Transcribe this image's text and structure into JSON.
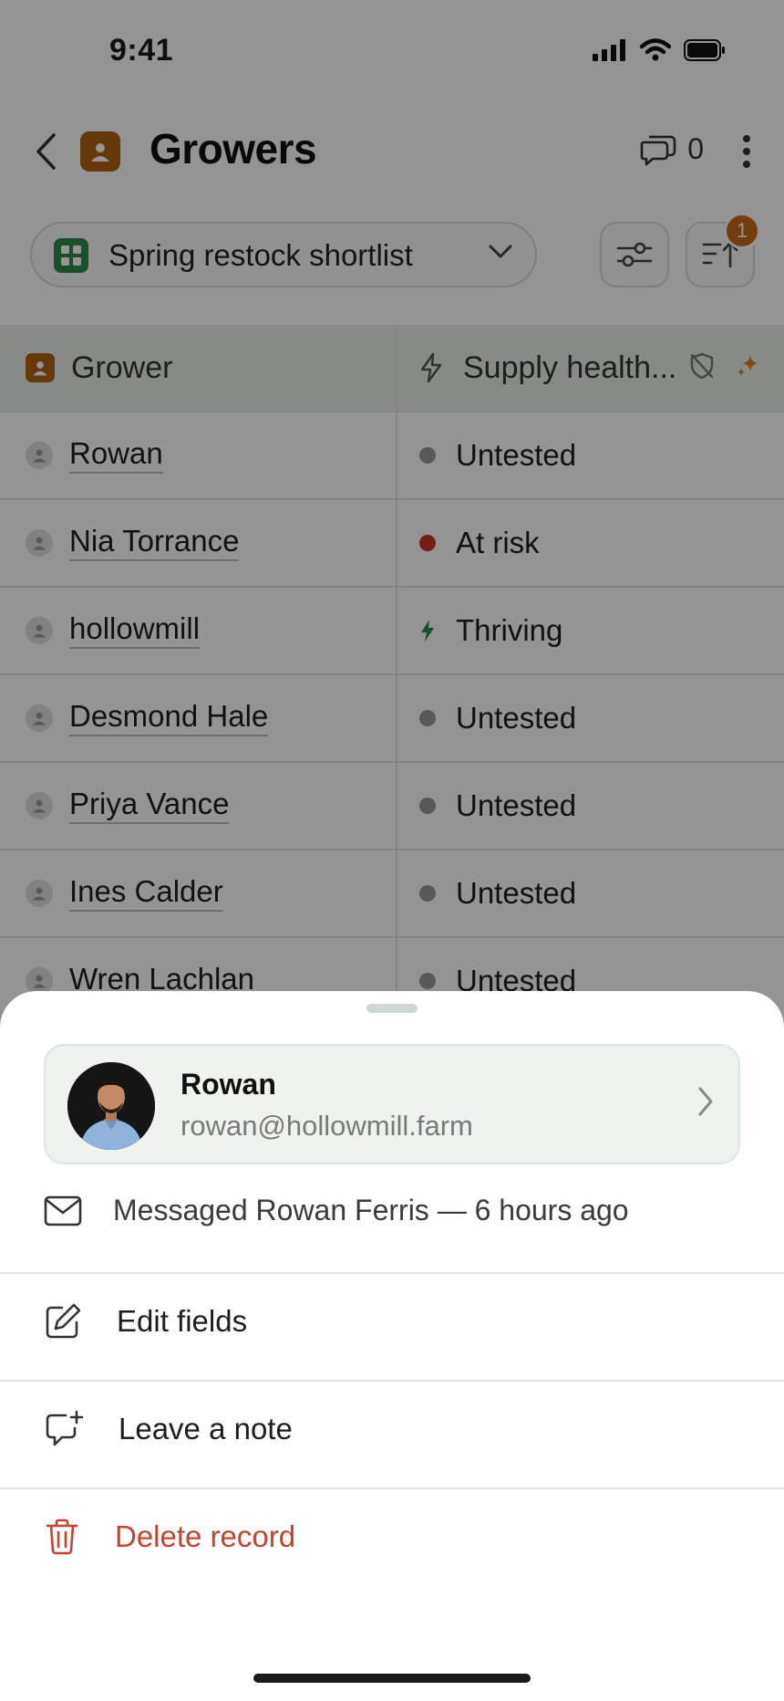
{
  "status_bar": {
    "time": "9:41"
  },
  "header": {
    "title": "Growers",
    "comments_count": "0"
  },
  "toolbar": {
    "view_name": "Spring restock shortlist",
    "sort_badge": "1"
  },
  "table": {
    "columns": [
      "Grower",
      "Supply health..."
    ],
    "rows": [
      {
        "name": "Rowan",
        "status": "Untested",
        "kind": "untested"
      },
      {
        "name": "Nia Torrance",
        "status": "At risk",
        "kind": "risk"
      },
      {
        "name": "hollowmill",
        "status": "Thriving",
        "kind": "thriving"
      },
      {
        "name": "Desmond Hale",
        "status": "Untested",
        "kind": "untested"
      },
      {
        "name": "Priya Vance",
        "status": "Untested",
        "kind": "untested"
      },
      {
        "name": "Ines Calder",
        "status": "Untested",
        "kind": "untested"
      },
      {
        "name": "Wren Lachlan",
        "status": "Untested",
        "kind": "untested"
      }
    ]
  },
  "sheet": {
    "profile": {
      "name": "Rowan",
      "email": "rowan@hollowmill.farm"
    },
    "activity": "Messaged Rowan Ferris — 6 hours ago",
    "actions": {
      "edit": "Edit fields",
      "note": "Leave a note",
      "delete": "Delete record"
    }
  },
  "colors": {
    "accent": "#b06214",
    "view_icon": "#2f8a4e",
    "danger": "#c4442f",
    "at_risk": "#c0392b",
    "thriving": "#2f8a4e"
  }
}
